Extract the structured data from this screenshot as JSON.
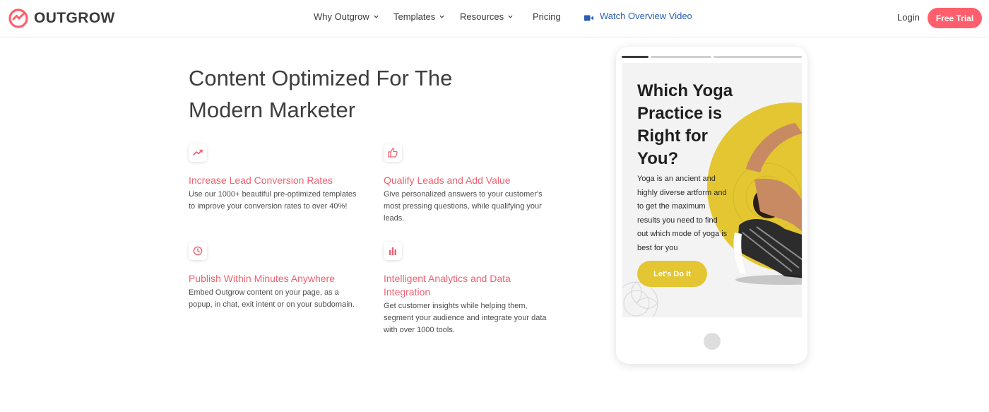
{
  "brand": {
    "name": "OUTGROW",
    "accent": "#ff5f6d"
  },
  "nav": {
    "items": [
      {
        "label": "Why Outgrow",
        "dropdown": true
      },
      {
        "label": "Templates",
        "dropdown": true
      },
      {
        "label": "Resources",
        "dropdown": true
      },
      {
        "label": "Pricing",
        "dropdown": false
      }
    ],
    "video_link": {
      "label": "Watch Overview Video",
      "icon": "video-camera-icon",
      "color": "#2b5fb3"
    },
    "login_label": "Login",
    "trial_label": "Free Trial"
  },
  "main": {
    "heading_line1": "Content Optimized For The",
    "heading_line2": "Modern Marketer",
    "features": [
      {
        "icon": "trend-line-icon",
        "title": "Increase Lead Conversion Rates",
        "desc": "Use our 1000+ beautiful pre-optimized templates to improve your conversion rates to over 40%!"
      },
      {
        "icon": "thumbs-up-icon",
        "title": "Qualify Leads and Add Value",
        "desc": "Give personalized answers to your customer's most pressing questions, while qualifying your leads."
      },
      {
        "icon": "clock-icon",
        "title": "Publish Within Minutes Anywhere",
        "desc": "Embed Outgrow content on your page, as a popup, in chat, exit intent or on your subdomain."
      },
      {
        "icon": "bar-chart-icon",
        "title": "Intelligent Analytics and Data Integration",
        "desc": "Get customer insights while helping them, segment your audience and integrate your data with over 1000 tools."
      }
    ]
  },
  "phone": {
    "progress_segments": 3,
    "progress_active": 1,
    "quiz_title": "Which Yoga Practice is Right for You?",
    "quiz_desc": "Yoga is an ancient and highly diverse artform and to get the maximum results you need to find out which mode of yoga is best for you",
    "cta_label": "Let's Do It",
    "accent": "#e3c631"
  }
}
